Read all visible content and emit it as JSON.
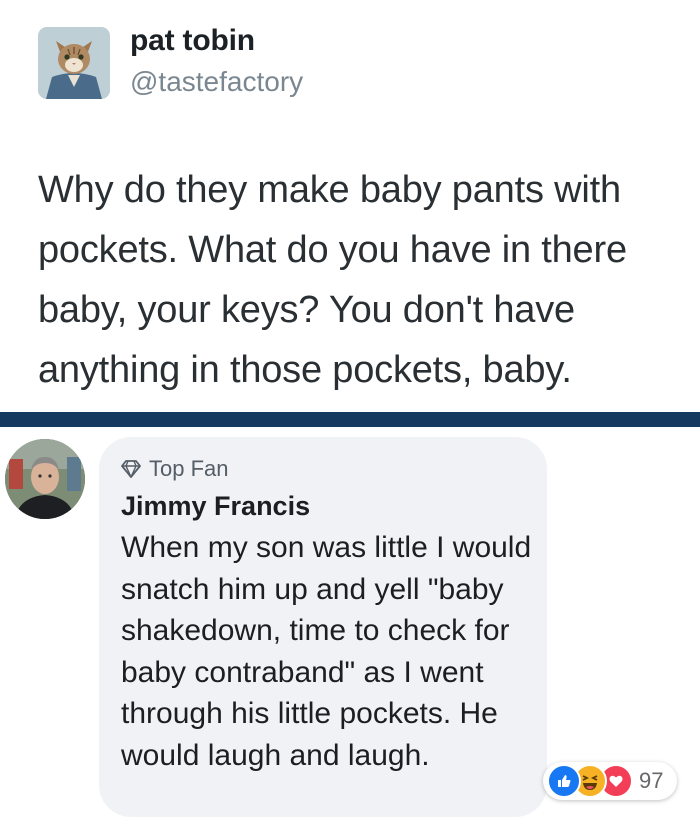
{
  "tweet": {
    "name": "pat tobin",
    "handle": "@tastefactory",
    "text": "Why do they make baby pants with pockets. What do you have in there baby, your keys? You don't have anything in those pockets, baby.",
    "avatar_icon": "cat-avatar-icon"
  },
  "comment": {
    "badge": "Top Fan",
    "badge_icon": "diamond-icon",
    "author": "Jimmy Francis",
    "text": "When my son was little I would snatch him up and yell \"baby shakedown, time to check for baby contraband\" as I went through his little pockets. He would laugh and laugh.",
    "avatar_icon": "man-avatar-icon",
    "reactions": {
      "icons": [
        "like-icon",
        "haha-icon",
        "love-icon"
      ],
      "count": "97"
    }
  },
  "colors": {
    "divider": "#163a5f",
    "bubble": "#f0f2f5",
    "like": "#1877f2",
    "haha": "#f7b125",
    "love": "#f33e58"
  }
}
